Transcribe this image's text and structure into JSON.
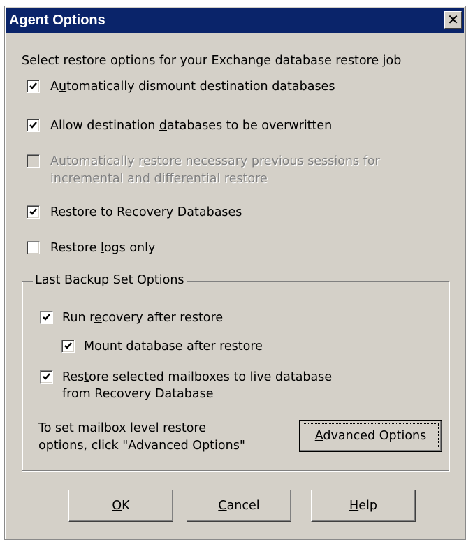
{
  "window": {
    "title": "Agent Options",
    "close_glyph": "✕"
  },
  "intro_text": "Select  restore options for your Exchange database restore job",
  "options": [
    {
      "pre": "A",
      "key": "u",
      "post": "tomatically dismount destination databases",
      "checked": true,
      "enabled": true
    },
    {
      "pre": "Allow destination ",
      "key": "d",
      "post": "atabases to be overwritten",
      "checked": true,
      "enabled": true
    },
    {
      "pre": "Automatically ",
      "key": "r",
      "post": "estore necessary  previous sessions for",
      "line2": "incremental and  differential  restore",
      "checked": false,
      "enabled": false
    },
    {
      "pre": "Re",
      "key": "s",
      "post": "tore to Recovery Databases",
      "checked": true,
      "enabled": true
    },
    {
      "pre": "Restore ",
      "key": "l",
      "post": "ogs only",
      "checked": false,
      "enabled": true
    }
  ],
  "group": {
    "legend": "Last Backup Set Options",
    "run_recovery": {
      "pre": "Run r",
      "key": "e",
      "post": "covery after restore",
      "checked": true
    },
    "mount_db": {
      "pre": "",
      "key": "M",
      "post": "ount database after restore",
      "checked": true
    },
    "restore_mailboxes": {
      "pre": "Res",
      "key": "t",
      "post": "ore selected mailboxes to live database",
      "line2": "from Recovery Database",
      "checked": true
    },
    "hint_line1": "To set mailbox level restore",
    "hint_line2": "options, click \"Advanced Options\"",
    "advanced_button": {
      "key": "A",
      "post": "dvanced Options"
    }
  },
  "buttons": {
    "ok": {
      "key": "O",
      "post": "K"
    },
    "cancel": {
      "key": "C",
      "post": "ancel"
    },
    "help": {
      "key": "H",
      "post": "elp"
    }
  },
  "icons": {
    "checkbox_mark": "check-mark-icon",
    "close": "close-icon"
  }
}
